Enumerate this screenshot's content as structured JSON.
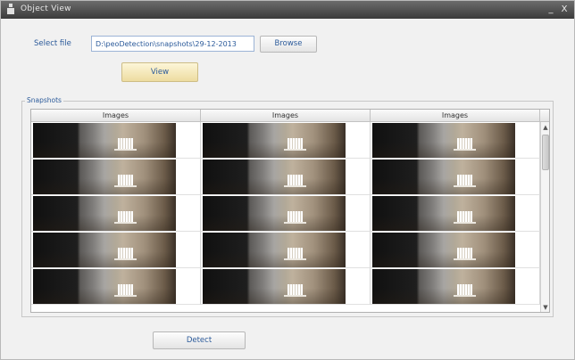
{
  "window": {
    "title": "Object View",
    "minimize_label": "_",
    "close_label": "X"
  },
  "form": {
    "select_file_label": "Select file",
    "file_path": "D:\\peoDetection\\snapshots\\29-12-2013",
    "browse_label": "Browse",
    "view_label": "View",
    "detect_label": "Detect"
  },
  "snapshots": {
    "group_label": "Snapshots",
    "columns": [
      "Images",
      "Images",
      "Images"
    ],
    "rows": 5
  },
  "icons": {
    "app": "app-icon",
    "minimize": "minimize-icon",
    "close": "close-icon",
    "scroll_up": "arrow-up-icon",
    "scroll_down": "arrow-down-icon"
  },
  "colors": {
    "label_blue": "#2b5a9a",
    "view_button": "#eddca0",
    "titlebar": "#3b3b3b"
  }
}
